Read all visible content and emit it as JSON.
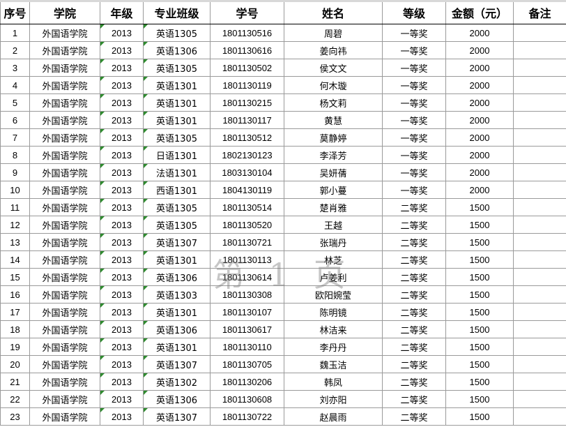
{
  "headers": [
    "序号",
    "学院",
    "年级",
    "专业班级",
    "学号",
    "姓名",
    "等级",
    "金额（元）",
    "备注"
  ],
  "watermark": "第 1 页",
  "rows": [
    [
      "1",
      "外国语学院",
      "2013",
      "英语1305",
      "1801130516",
      "周碧",
      "一等奖",
      "2000",
      ""
    ],
    [
      "2",
      "外国语学院",
      "2013",
      "英语1306",
      "1801130616",
      "姜向祎",
      "一等奖",
      "2000",
      ""
    ],
    [
      "3",
      "外国语学院",
      "2013",
      "英语1305",
      "1801130502",
      "侯文文",
      "一等奖",
      "2000",
      ""
    ],
    [
      "4",
      "外国语学院",
      "2013",
      "英语1301",
      "1801130119",
      "何木璇",
      "一等奖",
      "2000",
      ""
    ],
    [
      "5",
      "外国语学院",
      "2013",
      "英语1301",
      "1801130215",
      "杨文莉",
      "一等奖",
      "2000",
      ""
    ],
    [
      "6",
      "外国语学院",
      "2013",
      "英语1301",
      "1801130117",
      "黄慧",
      "一等奖",
      "2000",
      ""
    ],
    [
      "7",
      "外国语学院",
      "2013",
      "英语1305",
      "1801130512",
      "莫静婷",
      "一等奖",
      "2000",
      ""
    ],
    [
      "8",
      "外国语学院",
      "2013",
      "日语1301",
      "1802130123",
      "李泽芳",
      "一等奖",
      "2000",
      ""
    ],
    [
      "9",
      "外国语学院",
      "2013",
      "法语1301",
      "1803130104",
      "吴妍蒨",
      "一等奖",
      "2000",
      ""
    ],
    [
      "10",
      "外国语学院",
      "2013",
      "西语1301",
      "1804130119",
      "郭小蔓",
      "一等奖",
      "2000",
      ""
    ],
    [
      "11",
      "外国语学院",
      "2013",
      "英语1305",
      "1801130514",
      "楚肖雅",
      "二等奖",
      "1500",
      ""
    ],
    [
      "12",
      "外国语学院",
      "2013",
      "英语1305",
      "1801130520",
      "王越",
      "二等奖",
      "1500",
      ""
    ],
    [
      "13",
      "外国语学院",
      "2013",
      "英语1307",
      "1801130721",
      "张瑞丹",
      "二等奖",
      "1500",
      ""
    ],
    [
      "14",
      "外国语学院",
      "2013",
      "英语1301",
      "1801130113",
      "林芝",
      "二等奖",
      "1500",
      ""
    ],
    [
      "15",
      "外国语学院",
      "2013",
      "英语1306",
      "1801130614",
      "卢姜利",
      "二等奖",
      "1500",
      ""
    ],
    [
      "16",
      "外国语学院",
      "2013",
      "英语1303",
      "1801130308",
      "欧阳婉莹",
      "二等奖",
      "1500",
      ""
    ],
    [
      "17",
      "外国语学院",
      "2013",
      "英语1301",
      "1801130107",
      "陈明镜",
      "二等奖",
      "1500",
      ""
    ],
    [
      "18",
      "外国语学院",
      "2013",
      "英语1306",
      "1801130617",
      "林洁来",
      "二等奖",
      "1500",
      ""
    ],
    [
      "19",
      "外国语学院",
      "2013",
      "英语1301",
      "1801130110",
      "李丹丹",
      "二等奖",
      "1500",
      ""
    ],
    [
      "20",
      "外国语学院",
      "2013",
      "英语1307",
      "1801130705",
      "魏玉洁",
      "二等奖",
      "1500",
      ""
    ],
    [
      "21",
      "外国语学院",
      "2013",
      "英语1302",
      "1801130206",
      "韩凤",
      "二等奖",
      "1500",
      ""
    ],
    [
      "22",
      "外国语学院",
      "2013",
      "英语1306",
      "1801130608",
      "刘亦阳",
      "二等奖",
      "1500",
      ""
    ],
    [
      "23",
      "外国语学院",
      "2013",
      "英语1307",
      "1801130722",
      "赵晨雨",
      "二等奖",
      "1500",
      ""
    ]
  ],
  "accent_colors": {
    "cell_marker": "#2e8b2e",
    "grid": "#9a9a9a"
  }
}
